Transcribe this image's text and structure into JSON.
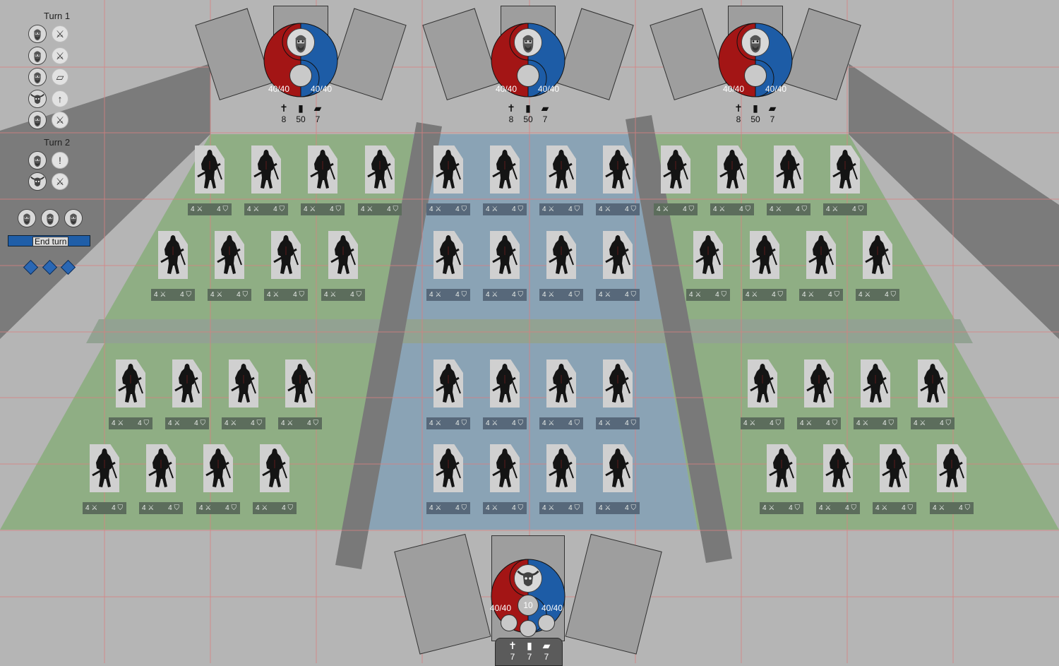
{
  "log": {
    "turns": [
      {
        "label": "Turn 1",
        "entries": [
          {
            "avatar": "bearded-hero-icon",
            "action": "crossed-swords-icon",
            "glyph": "⚔"
          },
          {
            "avatar": "bearded-hero-icon",
            "action": "crossed-swords-icon",
            "glyph": "⚔"
          },
          {
            "avatar": "bearded-hero-icon",
            "action": "card-icon",
            "glyph": "▱"
          },
          {
            "avatar": "horned-beast-icon",
            "action": "up-arrow-icon",
            "glyph": "↑"
          },
          {
            "avatar": "bearded-hero-icon",
            "action": "crossed-swords-icon",
            "glyph": "⚔"
          }
        ]
      },
      {
        "label": "Turn 2",
        "entries": [
          {
            "avatar": "bearded-hero-icon",
            "action": "exclamation-icon",
            "glyph": "!"
          },
          {
            "avatar": "horned-beast-icon",
            "action": "crossed-swords-icon",
            "glyph": "⚔"
          }
        ]
      }
    ]
  },
  "controls": {
    "end_turn_label": "End turn",
    "player_avatars": 3,
    "mana_diamonds": 3
  },
  "opponents": [
    {
      "hp_left": "40/40",
      "hp_right": "40/40",
      "graveyard": "8",
      "deck": "50",
      "hand": "7"
    },
    {
      "hp_left": "40/40",
      "hp_right": "40/40",
      "graveyard": "8",
      "deck": "50",
      "hand": "7"
    },
    {
      "hp_left": "40/40",
      "hp_right": "40/40",
      "graveyard": "8",
      "deck": "50",
      "hand": "7"
    }
  ],
  "player": {
    "hp_left": "40/40",
    "hp_right": "40/40",
    "mana": "10",
    "graveyard": "7",
    "deck": "7",
    "hand": "7"
  },
  "unit_stats": {
    "attack": "4",
    "defense": "4"
  },
  "colors": {
    "red": "#a31515",
    "blue": "#1d5ca6",
    "lane_green": "#8fae84",
    "lane_blue": "#8aa3b5"
  }
}
